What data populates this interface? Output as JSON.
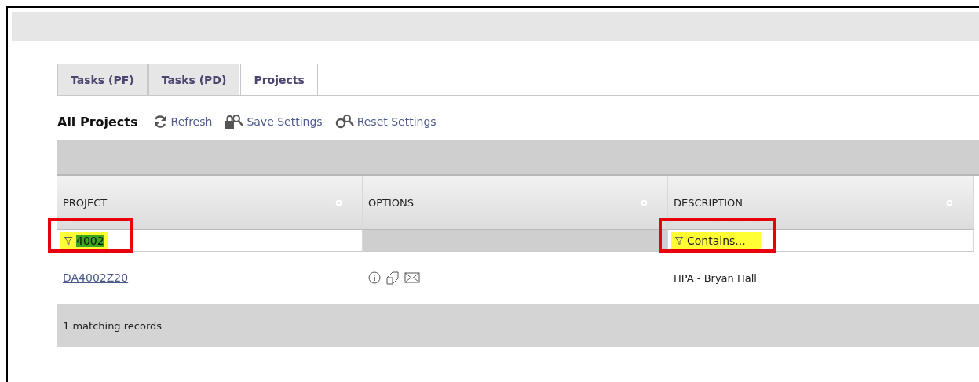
{
  "tabs": [
    {
      "label": "Tasks (PF)",
      "selected": false
    },
    {
      "label": "Tasks (PD)",
      "selected": false
    },
    {
      "label": "Projects",
      "selected": true
    }
  ],
  "toolbar": {
    "title": "All Projects",
    "actions": [
      {
        "kind": "refresh",
        "label": "Refresh"
      },
      {
        "kind": "save",
        "label": "Save Settings"
      },
      {
        "kind": "reset",
        "label": "Reset Settings"
      }
    ]
  },
  "table": {
    "columns": [
      {
        "label": "PROJECT",
        "filter": {
          "kind": "text",
          "value": "4002",
          "annotated": true
        }
      },
      {
        "label": "OPTIONS",
        "filter": {
          "kind": "none"
        }
      },
      {
        "label": "DESCRIPTION",
        "filter": {
          "kind": "text",
          "placeholder": "Contains...",
          "annotated": true
        }
      }
    ],
    "rows": [
      {
        "project": "DA4002Z20",
        "description": "HPA - Bryan Hall"
      }
    ],
    "footer": "1 matching records"
  }
}
